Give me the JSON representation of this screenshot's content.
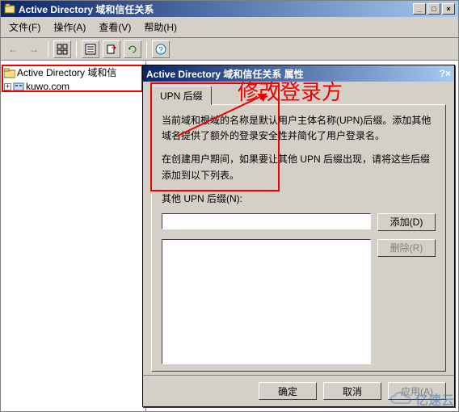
{
  "window": {
    "title": "Active Directory 域和信任关系",
    "controls": {
      "min": "_",
      "max": "□",
      "close": "×"
    }
  },
  "menu": {
    "file": "文件(F)",
    "action": "操作(A)",
    "view": "查看(V)",
    "help": "帮助(H)"
  },
  "toolbar_icons": {
    "back": "←",
    "forward": "→",
    "up": "⇧",
    "props": "▤",
    "copy": "⎘",
    "refresh": "⟳",
    "help": "?"
  },
  "tree": {
    "root": "Active Directory 域和信",
    "child": "kuwo.com",
    "expander": "+"
  },
  "dialog": {
    "title": "Active Directory 域和信任关系 属性",
    "help_btn": "?",
    "close_btn": "×",
    "tab_label": "UPN 后缀",
    "desc1": "当前域和根域的名称是默认用户主体名称(UPN)后缀。添加其他域名提供了额外的登录安全性并简化了用户登录名。",
    "desc2": "在创建用户期间，如果要让其他 UPN 后缀出现，请将这些后缀添加到以下列表。",
    "label_other": "其他 UPN 后缀(N):",
    "add": "添加(D)",
    "remove": "删除(R)",
    "ok": "确定",
    "cancel": "取消",
    "apply": "应用(A)"
  },
  "annotation": "修改登录方",
  "watermark": "亿速云"
}
